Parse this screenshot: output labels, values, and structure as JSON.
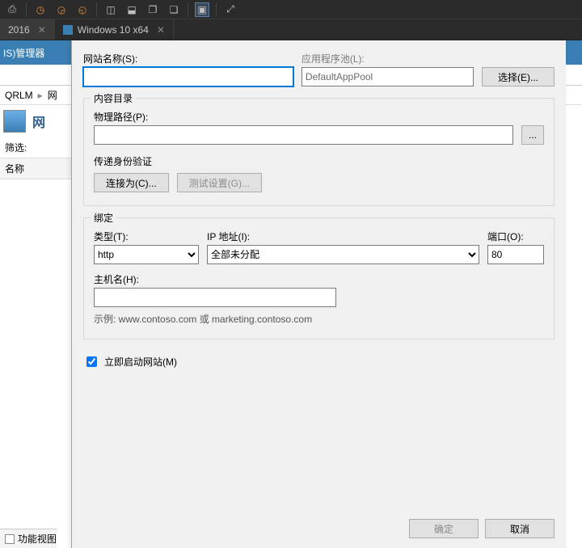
{
  "vm_tabs": [
    {
      "label": "2016",
      "active": true
    },
    {
      "label": "Windows 10 x64",
      "active": false
    }
  ],
  "iis": {
    "title_suffix": "IS)管理器",
    "breadcrumb_host": "QRLM",
    "breadcrumb_sep": "▸",
    "breadcrumb_sites": "网",
    "sites_heading": "网",
    "filter_label": "筛选:",
    "column_name": "名称",
    "footer_view": "功能视图"
  },
  "dialog": {
    "sitename_label": "网站名称(S):",
    "sitename_value": "",
    "apppool_label": "应用程序池(L):",
    "apppool_value": "DefaultAppPool",
    "select_button": "选择(E)...",
    "group_content_title": "内容目录",
    "physical_path_label": "物理路径(P):",
    "physical_path_value": "",
    "browse_button": "...",
    "passthrough_label": "传递身份验证",
    "connect_as_button": "连接为(C)...",
    "test_settings_button": "测试设置(G)...",
    "group_binding_title": "绑定",
    "type_label": "类型(T):",
    "type_value": "http",
    "ip_label": "IP 地址(I):",
    "ip_value": "全部未分配",
    "port_label": "端口(O):",
    "port_value": "80",
    "host_label": "主机名(H):",
    "host_value": "",
    "host_hint": "示例: www.contoso.com 或 marketing.contoso.com",
    "start_now_label": "立即启动网站(M)",
    "start_now_checked": true,
    "ok_button": "确定",
    "cancel_button": "取消"
  }
}
